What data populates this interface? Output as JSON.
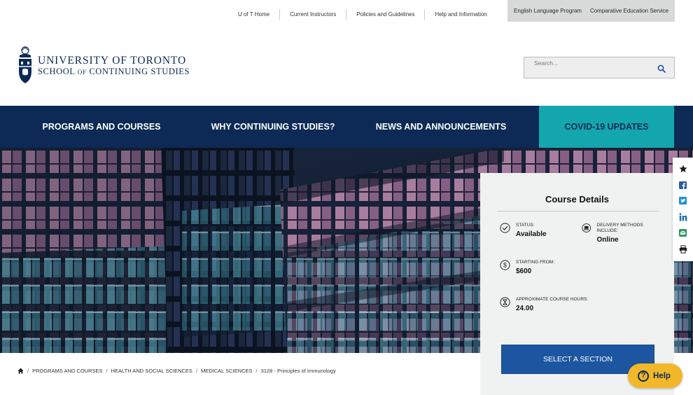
{
  "utility_nav": {
    "links": [
      "U of T Home",
      "Current Instructors",
      "Policies and Guidelines",
      "Help and Information"
    ],
    "grey_links": [
      "English Language Program",
      "Comparative Education Service"
    ]
  },
  "logo": {
    "line1": "UNIVERSITY OF TORONTO",
    "line2_a": "SCHOOL ",
    "line2_of": "OF",
    "line2_b": " CONTINUING STUDIES"
  },
  "search": {
    "placeholder": "Search...",
    "icon": "search-icon"
  },
  "main_nav": {
    "items": [
      "PROGRAMS AND COURSES",
      "WHY CONTINUING STUDIES?",
      "NEWS AND ANNOUNCEMENTS"
    ],
    "covid": "COVID-19 UPDATES"
  },
  "breadcrumb": {
    "home_icon": "home-icon",
    "items": [
      "PROGRAMS AND COURSES",
      "HEALTH AND SOCIAL SCIENCES",
      "MEDICAL SCIENCES",
      "3128 - Principles of Immunology"
    ]
  },
  "course_details": {
    "title": "Course Details",
    "status_label": "STATUS:",
    "status_value": "Available",
    "delivery_label": "DELIVERY METHODS INCLUDE:",
    "delivery_value": "Online",
    "price_label": "STARTING FROM:",
    "price_value": "$600",
    "hours_label": "APPROXIMATE COURSE HOURS:",
    "hours_value": "24.00",
    "select_button": "SELECT A SECTION"
  },
  "share_icons": [
    "star-icon",
    "facebook-icon",
    "twitter-icon",
    "linkedin-icon",
    "email-icon",
    "print-icon"
  ],
  "help": {
    "label": "Help"
  },
  "colors": {
    "navy": "#0c2a55",
    "teal": "#14a6ad",
    "button_blue": "#1d56a0",
    "help_yellow": "#f2b829",
    "panel_grey": "#f0f1f1"
  }
}
